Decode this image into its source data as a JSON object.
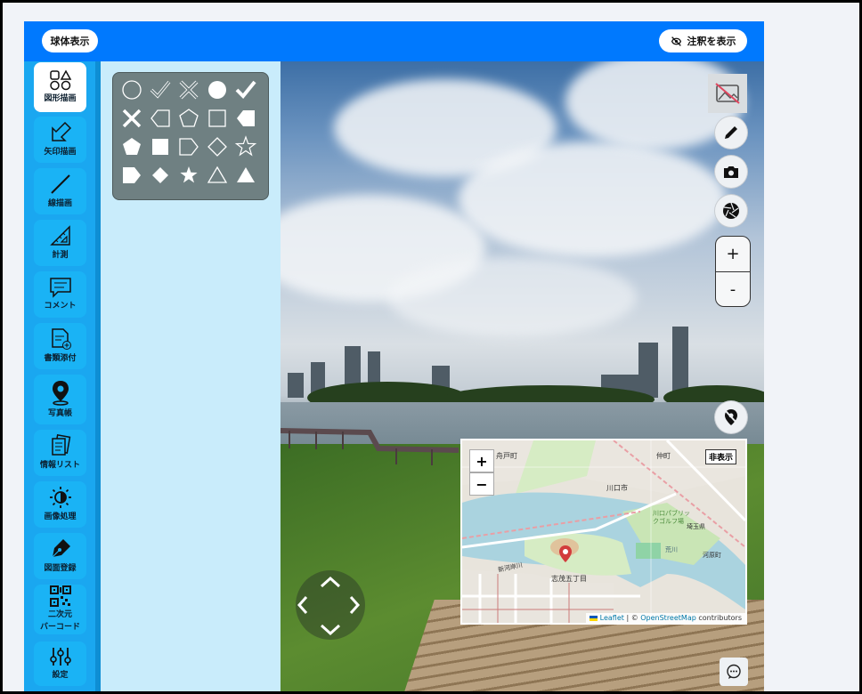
{
  "topbar": {
    "sphere_label": "球体表示",
    "annotation_label": "注釈を表示"
  },
  "sidebar": {
    "items": [
      {
        "label": "図形描画",
        "icon": "shapes-icon"
      },
      {
        "label": "矢印描画",
        "icon": "arrow-draw-icon"
      },
      {
        "label": "線描画",
        "icon": "line-draw-icon"
      },
      {
        "label": "計測",
        "icon": "ruler-icon"
      },
      {
        "label": "コメント",
        "icon": "comment-icon"
      },
      {
        "label": "書類添付",
        "icon": "document-attach-icon"
      },
      {
        "label": "写真帳",
        "icon": "map-pin-icon"
      },
      {
        "label": "情報リスト",
        "icon": "info-list-icon"
      },
      {
        "label": "画像処理",
        "icon": "brightness-icon"
      },
      {
        "label": "図面登録",
        "icon": "pen-nib-icon"
      },
      {
        "label": "二次元\nバーコード",
        "icon": "qr-code-icon"
      },
      {
        "label": "設定",
        "icon": "sliders-icon"
      }
    ]
  },
  "shapes": [
    "circle-outline",
    "check-outline",
    "x-outline",
    "circle-filled",
    "check-filled",
    "x-filled",
    "arrow-tag-left-outline",
    "pentagon-outline",
    "square-outline",
    "arrow-tag-left-filled",
    "pentagon-filled",
    "square-filled",
    "tag-right-outline",
    "diamond-outline",
    "star-outline",
    "tag-right-filled",
    "diamond-filled",
    "star-filled",
    "triangle-outline",
    "triangle-filled"
  ],
  "viewer": {
    "zoom_in": "+",
    "zoom_out": "-"
  },
  "minimap": {
    "hide_label": "非表示",
    "zoom_in": "+",
    "zoom_out": "−",
    "labels": [
      "舟戸町",
      "川口市",
      "仲町",
      "埼玉県",
      "河原町",
      "新河岸川",
      "志茂五丁目",
      "川口パブリックゴルフ場",
      "荒川"
    ],
    "attribution": {
      "leaflet": "Leaflet",
      "sep": " | © ",
      "osm": "OpenStreetMap",
      "tail": " contributors"
    }
  },
  "colors": {
    "topbar": "#0079fe",
    "sidebar": "#1aa7f0",
    "panel": "#c9ecfb"
  }
}
